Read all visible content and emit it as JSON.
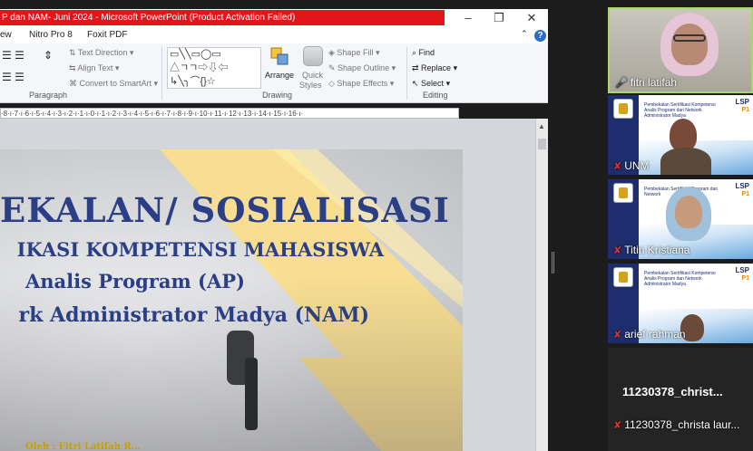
{
  "window": {
    "title": "P dan NAM- Juni 2024  -  Microsoft PowerPoint (Product Activation Failed)",
    "minimize": "–",
    "restore": "❐",
    "close": "✕"
  },
  "menu": {
    "tabs": [
      "ew",
      "Nitro Pro 8",
      "Foxit PDF"
    ],
    "help": "?",
    "caret": "⌃"
  },
  "ribbon": {
    "paragraph": {
      "label": "Paragraph",
      "text_direction": "Text Direction",
      "align_text": "Align Text",
      "convert_smartart": "Convert to SmartArt"
    },
    "drawing": {
      "label": "Drawing",
      "arrange": "Arrange",
      "quick_styles_1": "Quick",
      "quick_styles_2": "Styles",
      "shape_fill": "Shape Fill",
      "shape_outline": "Shape Outline",
      "shape_effects": "Shape Effects"
    },
    "editing": {
      "label": "Editing",
      "find": "Find",
      "replace": "Replace",
      "select": "Select"
    },
    "shape_glyphs": [
      "▭╲╲▭◯▭",
      "△ㄱㄱ⇨⇩⇦",
      "↳╲╮⌒{}☆"
    ]
  },
  "ruler": {
    "text": "·8·ı·7·ı·6·ı·5·ı·4·ı·3·ı·2·ı·1·ı·0·ı·1·ı·2·ı·3·ı·4·ı·5·ı·6·ı·7·ı·8·ı·9·ı·10·ı·11·ı·12·ı·13·ı·14·ı·15·ı·16·ı·"
  },
  "slide": {
    "title_line1": "EKALAN/ SOSIALISASI",
    "title_line2": "IKASI KOMPETENSI MAHASISWA",
    "title_line3": "Analis Program (AP)",
    "title_line4": "rk Administrator Madya (NAM)",
    "author_fragment": "Oleh : Fitri Latifah R...",
    "colors": {
      "navy": "#2b3f86",
      "gold": "#f2b705"
    }
  },
  "participants": [
    {
      "name": "fitri latifah",
      "mic": "on",
      "active": true
    },
    {
      "name": "UNM",
      "mic": "muted",
      "active": false
    },
    {
      "name": "Titin Kristiana",
      "mic": "muted",
      "active": false
    },
    {
      "name": "arief rahman",
      "mic": "muted",
      "active": false
    },
    {
      "name": "11230378_christ...",
      "mic": "none",
      "active": false
    },
    {
      "name": "11230378_christa laur...",
      "mic": "muted",
      "active": false
    }
  ],
  "card": {
    "brand_1": "LSP",
    "brand_2": "P1",
    "text_2": "Pembekalan Sertifikasi Kompetensi Analis Program dan Network Administrator Madya",
    "text_3": "Pembekalan Sertifikasi Program dan Network",
    "text_4": "Pembekalan Sertifikasi Kompetensi Analis Program dan Network Administrator Madya"
  }
}
